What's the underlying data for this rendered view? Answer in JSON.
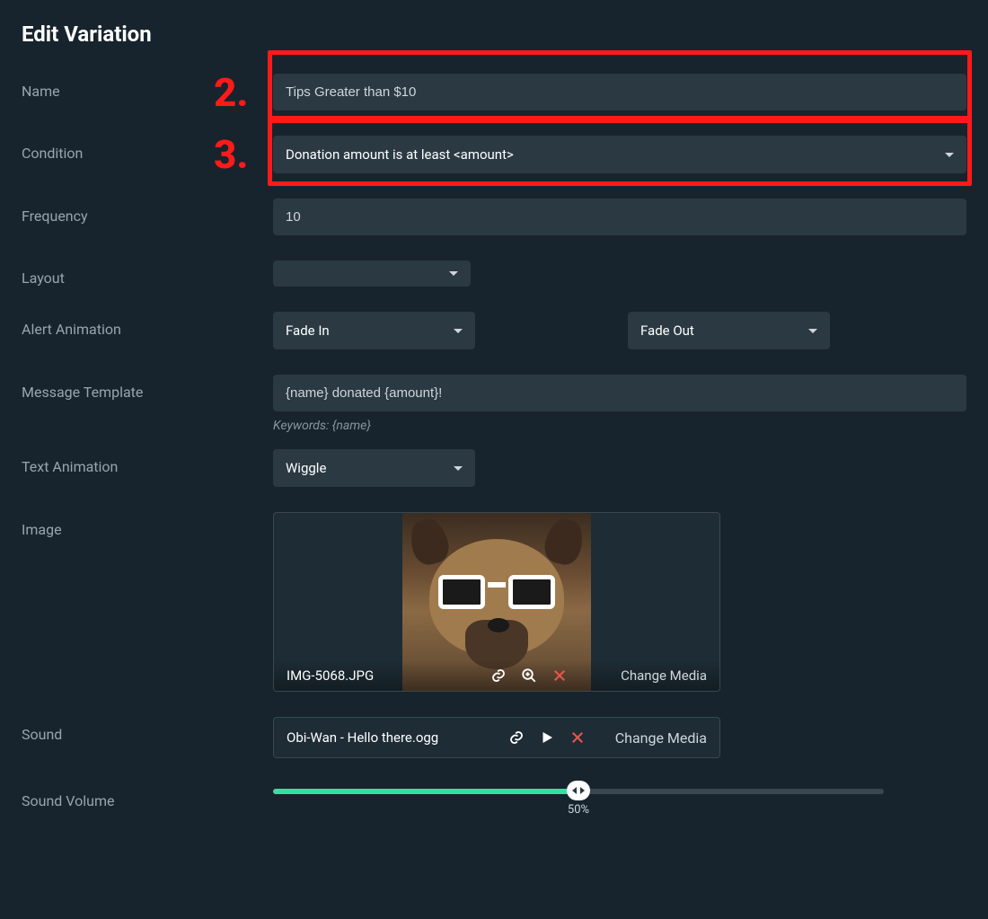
{
  "title": "Edit Variation",
  "annotations": {
    "step2": "2.",
    "step3": "3."
  },
  "labels": {
    "name": "Name",
    "condition": "Condition",
    "frequency": "Frequency",
    "layout": "Layout",
    "alertAnimation": "Alert Animation",
    "messageTemplate": "Message Template",
    "textAnimation": "Text Animation",
    "image": "Image",
    "sound": "Sound",
    "soundVolume": "Sound Volume"
  },
  "fields": {
    "name": "Tips Greater than $10",
    "condition": "Donation amount is at least <amount>",
    "frequency": "10",
    "layout": "",
    "animationIn": "Fade In",
    "animationOut": "Fade Out",
    "messageTemplate": "{name} donated {amount}!",
    "keywordsHelp": "Keywords: {name}",
    "textAnimation": "Wiggle"
  },
  "image": {
    "filename": "IMG-5068.JPG",
    "changeMedia": "Change Media"
  },
  "sound": {
    "filename": "Obi-Wan - Hello there.ogg",
    "changeMedia": "Change Media"
  },
  "volume": {
    "percent": 50,
    "label": "50%"
  }
}
